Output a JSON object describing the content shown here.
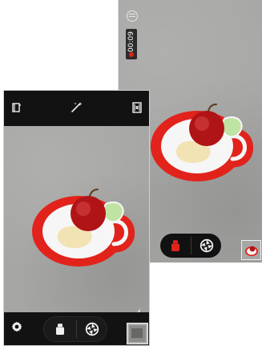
{
  "screenshot": {
    "top_right_screen": {
      "recording_time": "00:09",
      "icons": {
        "menu": "menu-icon",
        "record_indicator": "recording-dot-icon",
        "mode_video": "video-mode-icon",
        "shutter": "shutter-icon",
        "gallery_thumbnail": "gallery-thumbnail"
      }
    },
    "left_screen": {
      "icons": {
        "top_left": "camera-settings-icon",
        "top_center": "magic-wand-icon",
        "top_right": "film-mode-icon",
        "bottom_left": "gear-icon",
        "mode_video": "video-mode-icon",
        "shutter": "shutter-icon",
        "side_flash": "flash-auto-icon",
        "side_switch_camera": "switch-camera-icon",
        "gallery_thumbnail": "gallery-thumbnail"
      }
    },
    "colors": {
      "plate_red": "#e1231b",
      "plate_white": "#f6f6f6",
      "apple_red": "#b11416",
      "leaf_green": "#bfe3a2",
      "ui_black": "#111111",
      "ui_white": "#f0f0f0"
    }
  }
}
